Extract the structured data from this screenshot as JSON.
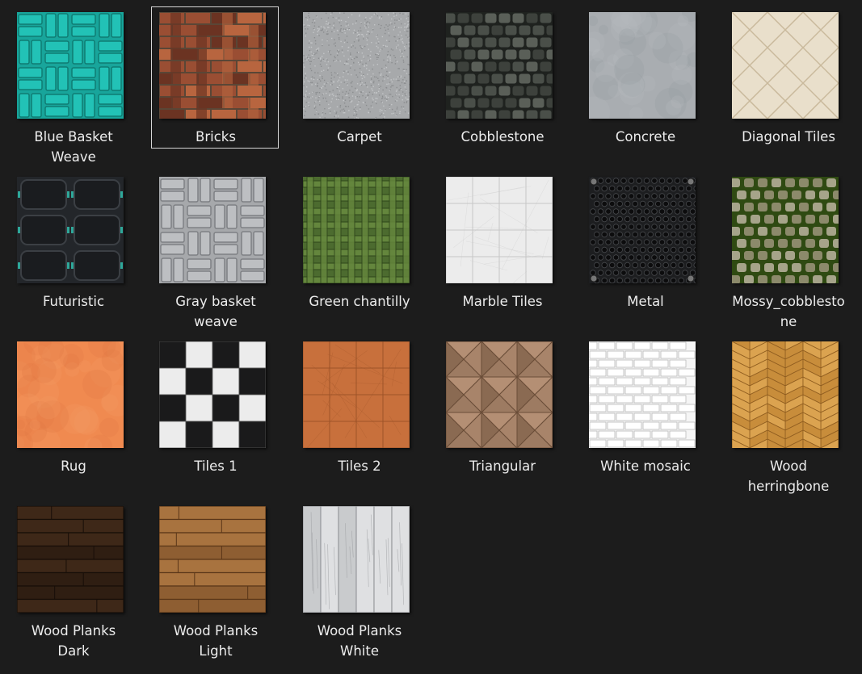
{
  "selected_index": 1,
  "materials": [
    {
      "label": "Blue Basket Weave",
      "pattern": "basket",
      "colors": [
        "#18a59b",
        "#0f7c73",
        "#22c2b6"
      ]
    },
    {
      "label": "Bricks",
      "pattern": "herringbone-brick",
      "colors": [
        "#9a4e33",
        "#6b3322",
        "#b8653f"
      ]
    },
    {
      "label": "Carpet",
      "pattern": "speckle",
      "colors": [
        "#a7a9ab",
        "#8a8c8e",
        "#c4c6c8"
      ]
    },
    {
      "label": "Cobblestone",
      "pattern": "cobble",
      "colors": [
        "#3d413c",
        "#1f221f",
        "#5a5f58"
      ]
    },
    {
      "label": "Concrete",
      "pattern": "plain",
      "colors": [
        "#a9adb1",
        "#959a9f",
        "#b7bbbf"
      ]
    },
    {
      "label": "Diagonal Tiles",
      "pattern": "diagonal",
      "colors": [
        "#e9dfcb",
        "#c9b99c",
        "#f1e9da"
      ]
    },
    {
      "label": "Futuristic",
      "pattern": "futuristic",
      "colors": [
        "#23262a",
        "#101214",
        "#2ea89a"
      ]
    },
    {
      "label": "Gray basket weave",
      "pattern": "basket",
      "colors": [
        "#a6a8ab",
        "#7e8084",
        "#bdbfc2"
      ]
    },
    {
      "label": "Green chantilly",
      "pattern": "chantilly",
      "colors": [
        "#4c6b2f",
        "#2e451a",
        "#64863d"
      ]
    },
    {
      "label": "Marble Tiles",
      "pattern": "grid",
      "colors": [
        "#ececec",
        "#c6c6c6",
        "#f7f7f7"
      ]
    },
    {
      "label": "Metal",
      "pattern": "metal",
      "colors": [
        "#1d1e20",
        "#0c0c0d",
        "#45474a"
      ]
    },
    {
      "label": "Mossy_cobblestone",
      "pattern": "mossy",
      "colors": [
        "#8c8a6b",
        "#2f4a12",
        "#a6a48a"
      ]
    },
    {
      "label": "Rug",
      "pattern": "plain",
      "colors": [
        "#f08a50",
        "#de7842",
        "#f59a62"
      ]
    },
    {
      "label": "Tiles 1",
      "pattern": "checker",
      "colors": [
        "#ececec",
        "#1a1a1b",
        "#d6d6d6"
      ]
    },
    {
      "label": "Tiles 2",
      "pattern": "grid",
      "colors": [
        "#c8703c",
        "#9e5328",
        "#d47d46"
      ]
    },
    {
      "label": "Triangular",
      "pattern": "triangular",
      "colors": [
        "#9d7b62",
        "#6a4d38",
        "#b48f74"
      ]
    },
    {
      "label": "White mosaic",
      "pattern": "mosaic",
      "colors": [
        "#f5f5f5",
        "#b9b9b9",
        "#ffffff"
      ]
    },
    {
      "label": "Wood herringbone",
      "pattern": "herringbone-wood",
      "colors": [
        "#c88d3b",
        "#8f5d20",
        "#dba350"
      ]
    },
    {
      "label": "Wood Planks Dark",
      "pattern": "planks",
      "colors": [
        "#2f1e12",
        "#170e08",
        "#3e2818"
      ]
    },
    {
      "label": "Wood Planks Light",
      "pattern": "planks",
      "colors": [
        "#8e5e32",
        "#5a3618",
        "#a8733f"
      ]
    },
    {
      "label": "Wood Planks White",
      "pattern": "planks-vertical",
      "colors": [
        "#c9cbcd",
        "#9a9c9f",
        "#dfe0e2"
      ]
    }
  ]
}
